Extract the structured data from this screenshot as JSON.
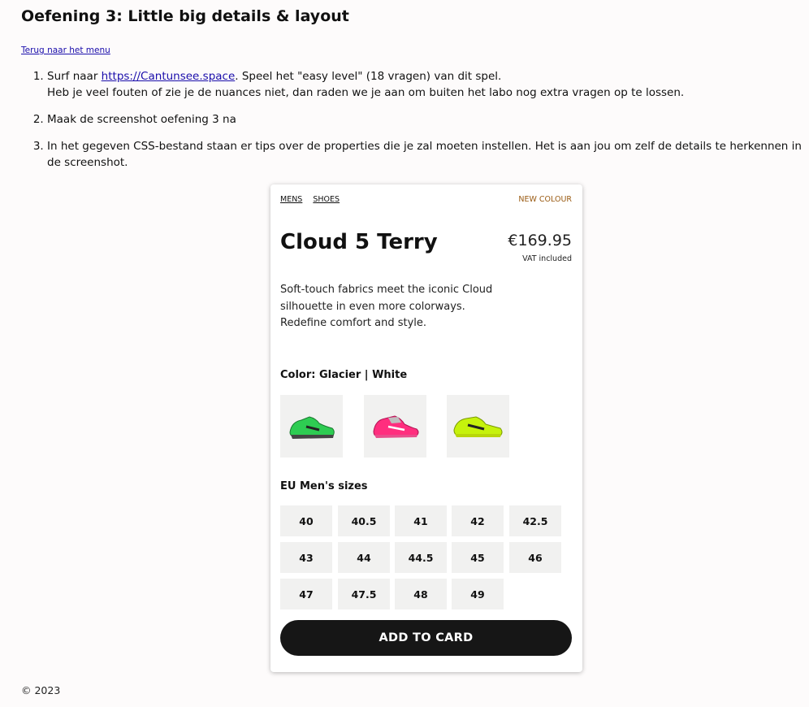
{
  "page": {
    "title": "Oefening 3: Little big details & layout",
    "back_link": "Terug naar het menu",
    "footer": "© 2023"
  },
  "instructions": {
    "item1_before": "Surf naar ",
    "item1_link": "https://Cantunsee.space",
    "item1_after": ". Speel het \"easy level\" (18 vragen) van dit spel.",
    "item1_line2": "Heb je veel fouten of zie je de nuances niet, dan raden we je aan om buiten het labo nog extra vragen op te lossen.",
    "item2": "Maak de screenshot oefening 3 na",
    "item3": "In het gegeven CSS-bestand staan er tips over de properties die je zal moeten instellen. Het is aan jou om zelf de details te herkennen in de screenshot."
  },
  "product": {
    "breadcrumb": [
      "MENS",
      "SHOES"
    ],
    "tag": "NEW COLOUR",
    "name": "Cloud 5 Terry",
    "price": "€169.95",
    "vat": "VAT included",
    "description": "Soft-touch fabrics meet the iconic Cloud silhouette in even more colorways. Redefine comfort and style.",
    "color_label": "Color: Glacier | White",
    "swatches": [
      {
        "icon": "green-shoe-icon",
        "color": "#2ecc52"
      },
      {
        "icon": "pink-shoe-icon",
        "color": "#ff2e7e"
      },
      {
        "icon": "yellow-shoe-icon",
        "color": "#c6f20c"
      }
    ],
    "sizes_label": "EU Men's sizes",
    "sizes": [
      "40",
      "40.5",
      "41",
      "42",
      "42.5",
      "43",
      "44",
      "44.5",
      "45",
      "46",
      "47",
      "47.5",
      "48",
      "49"
    ],
    "add_button": "ADD TO CARD"
  }
}
